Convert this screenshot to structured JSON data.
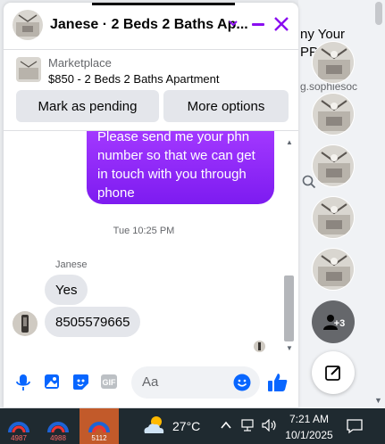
{
  "background": {
    "title": "ny Your\nPPC",
    "url": "g.sophiesoc"
  },
  "chat": {
    "title": "Janese · 2 Beds 2 Baths Ap...",
    "marketplace_label": "Marketplace",
    "listing": "$850 - 2 Beds 2 Baths Apartment",
    "mark_pending": "Mark as pending",
    "more_options": "More options",
    "outgoing_text": "Please send me your phn number so that we can get in touch with you through phone",
    "timestamp": "Tue 10:25 PM",
    "sender_name": "Janese",
    "messages": [
      "Yes",
      "8505579665"
    ],
    "input_placeholder": "Aa"
  },
  "side": {
    "more_count": "+3"
  },
  "taskbar": {
    "apps": [
      "4987",
      "4988",
      "5112"
    ],
    "temperature": "27°C",
    "time": "7:21 AM",
    "date": "10/1/2025"
  },
  "colors": {
    "accent": "#8a0df0",
    "bubble_in": "#e4e6eb",
    "icon_blue": "#0866ff"
  }
}
